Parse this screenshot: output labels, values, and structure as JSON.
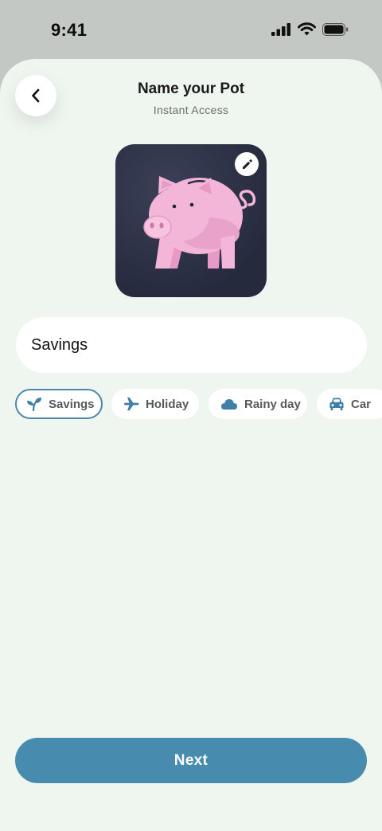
{
  "status_bar": {
    "time": "9:41"
  },
  "header": {
    "title": "Name your Pot",
    "subtitle": "Instant Access"
  },
  "pot_image": {
    "icon": "piggy-bank-icon",
    "edit_icon": "pencil-icon"
  },
  "name_input": {
    "value": "Savings"
  },
  "suggestions": [
    {
      "label": "Savings",
      "icon": "sprout-icon",
      "selected": true
    },
    {
      "label": "Holiday",
      "icon": "airplane-icon",
      "selected": false
    },
    {
      "label": "Rainy day",
      "icon": "cloud-icon",
      "selected": false
    },
    {
      "label": "Car",
      "icon": "car-icon",
      "selected": false
    }
  ],
  "next_button": {
    "label": "Next"
  },
  "colors": {
    "accent": "#478caf",
    "background": "#eff5ef",
    "pig": "#f3b6d8"
  }
}
